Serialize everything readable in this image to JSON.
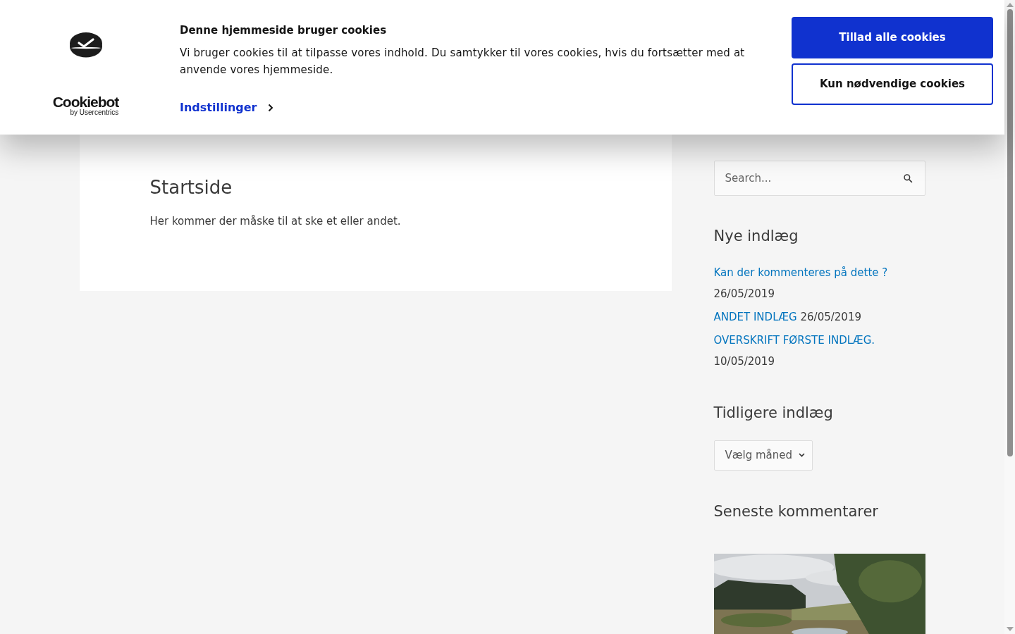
{
  "cookie_banner": {
    "logo_text": "Cookiebot",
    "logo_subtext": "by Usercentrics",
    "title": "Denne hjemmeside bruger cookies",
    "text": "Vi bruger cookies til at tilpasse vores indhold. Du samtykker til vores cookies, hvis du fortsætter med at anvende vores hjemmeside.",
    "settings_link": "Indstillinger",
    "buttons": [
      {
        "label": "Tillad alle cookies",
        "kind": "primary"
      },
      {
        "label": "Kun nødvendige cookies",
        "kind": "outline"
      }
    ]
  },
  "main": {
    "title": "Startside",
    "text": "Her kommer der måske til at ske et eller andet."
  },
  "sidebar": {
    "search": {
      "placeholder": "Search..."
    },
    "recent_title": "Nye indlæg",
    "recent_posts": [
      {
        "title": "Kan der kommenteres på dette ?",
        "date": "26/05/2019"
      },
      {
        "title": "ANDET INDLÆG",
        "date": "26/05/2019"
      },
      {
        "title": "OVERSKRIFT FØRSTE INDLÆG.",
        "date": "10/05/2019"
      }
    ],
    "archive_title": "Tidligere indlæg",
    "archive_select": "Vælg måned",
    "comments_title": "Seneste kommentarer"
  }
}
